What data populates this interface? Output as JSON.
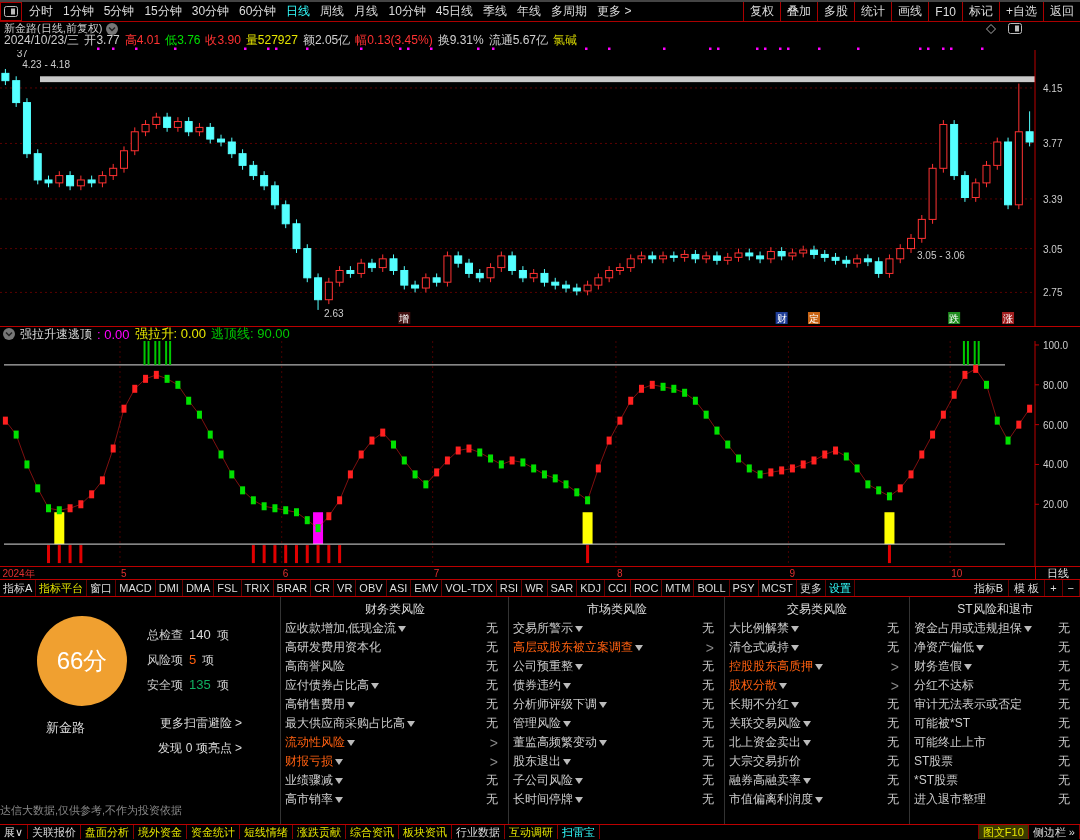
{
  "toolbar": {
    "periods": [
      {
        "label": "分时",
        "selected": false
      },
      {
        "label": "1分钟",
        "selected": false
      },
      {
        "label": "5分钟",
        "selected": false
      },
      {
        "label": "15分钟",
        "selected": false
      },
      {
        "label": "30分钟",
        "selected": false
      },
      {
        "label": "60分钟",
        "selected": false
      },
      {
        "label": "日线",
        "selected": true
      },
      {
        "label": "周线",
        "selected": false
      },
      {
        "label": "月线",
        "selected": false
      },
      {
        "label": "10分钟",
        "selected": false
      },
      {
        "label": "45日线",
        "selected": false
      },
      {
        "label": "季线",
        "selected": false
      },
      {
        "label": "年线",
        "selected": false
      },
      {
        "label": "多周期",
        "selected": false
      },
      {
        "label": "更多 >",
        "selected": false
      }
    ],
    "buttons": [
      "复权",
      "叠加",
      "多股",
      "统计",
      "画线",
      "F10",
      "标记",
      "+自选",
      "返回"
    ]
  },
  "quote": {
    "title": "新金路(日线,前复权)",
    "date": "2024/10/23/三",
    "fields": [
      {
        "label": "开",
        "value": "3.77",
        "color": "#d0d0d0"
      },
      {
        "label": "高",
        "value": "4.01",
        "color": "#ff3232"
      },
      {
        "label": "低",
        "value": "3.76",
        "color": "#00e000"
      },
      {
        "label": "收",
        "value": "3.90",
        "color": "#ff3232"
      },
      {
        "label": "量",
        "value": "527927",
        "color": "#e6e600"
      },
      {
        "label": "额",
        "value": "2.05亿",
        "color": "#d0d0d0"
      },
      {
        "label": "幅",
        "value": "0.13(3.45%)",
        "color": "#ff3232"
      },
      {
        "label": "换",
        "value": "9.31%",
        "color": "#d0d0d0"
      },
      {
        "label": "流通",
        "value": "5.67亿",
        "color": "#d0d0d0"
      }
    ],
    "sector": "氯碱"
  },
  "main_chart": {
    "chart_data": {
      "type": "candlestick",
      "ylim": [
        2.52,
        4.41
      ],
      "yticks": [
        2.75,
        3.05,
        3.39,
        3.77,
        4.15
      ],
      "grid": true,
      "ohlc": [
        [
          4.25,
          4.28,
          4.17,
          4.2
        ],
        [
          4.2,
          4.23,
          4.02,
          4.05
        ],
        [
          4.05,
          4.08,
          3.67,
          3.7
        ],
        [
          3.7,
          3.73,
          3.49,
          3.52
        ],
        [
          3.52,
          3.55,
          3.47,
          3.5
        ],
        [
          3.5,
          3.58,
          3.47,
          3.55
        ],
        [
          3.55,
          3.58,
          3.45,
          3.48
        ],
        [
          3.48,
          3.55,
          3.45,
          3.52
        ],
        [
          3.52,
          3.55,
          3.47,
          3.5
        ],
        [
          3.5,
          3.58,
          3.47,
          3.55
        ],
        [
          3.55,
          3.63,
          3.52,
          3.6
        ],
        [
          3.6,
          3.75,
          3.57,
          3.72
        ],
        [
          3.72,
          3.88,
          3.69,
          3.85
        ],
        [
          3.85,
          3.93,
          3.82,
          3.9
        ],
        [
          3.9,
          3.98,
          3.87,
          3.95
        ],
        [
          3.95,
          3.98,
          3.85,
          3.88
        ],
        [
          3.88,
          3.95,
          3.85,
          3.92
        ],
        [
          3.92,
          3.95,
          3.82,
          3.85
        ],
        [
          3.85,
          3.91,
          3.82,
          3.88
        ],
        [
          3.88,
          3.91,
          3.77,
          3.8
        ],
        [
          3.8,
          3.83,
          3.75,
          3.78
        ],
        [
          3.78,
          3.81,
          3.67,
          3.7
        ],
        [
          3.7,
          3.73,
          3.59,
          3.62
        ],
        [
          3.62,
          3.65,
          3.52,
          3.55
        ],
        [
          3.55,
          3.58,
          3.45,
          3.48
        ],
        [
          3.48,
          3.51,
          3.32,
          3.35
        ],
        [
          3.35,
          3.38,
          3.19,
          3.22
        ],
        [
          3.22,
          3.25,
          3.02,
          3.05
        ],
        [
          3.05,
          3.08,
          2.82,
          2.85
        ],
        [
          2.85,
          2.88,
          2.63,
          2.7
        ],
        [
          2.7,
          2.85,
          2.67,
          2.82
        ],
        [
          2.82,
          2.93,
          2.79,
          2.9
        ],
        [
          2.9,
          2.93,
          2.85,
          2.88
        ],
        [
          2.88,
          2.98,
          2.85,
          2.95
        ],
        [
          2.95,
          2.98,
          2.89,
          2.92
        ],
        [
          2.92,
          3.01,
          2.89,
          2.98
        ],
        [
          2.98,
          3.01,
          2.87,
          2.9
        ],
        [
          2.9,
          2.93,
          2.77,
          2.8
        ],
        [
          2.8,
          2.83,
          2.75,
          2.78
        ],
        [
          2.78,
          2.88,
          2.75,
          2.85
        ],
        [
          2.85,
          2.88,
          2.79,
          2.82
        ],
        [
          2.82,
          3.03,
          2.79,
          3.0
        ],
        [
          3.0,
          3.03,
          2.92,
          2.95
        ],
        [
          2.95,
          2.98,
          2.85,
          2.88
        ],
        [
          2.88,
          2.91,
          2.82,
          2.85
        ],
        [
          2.85,
          2.95,
          2.82,
          2.92
        ],
        [
          2.92,
          3.03,
          2.89,
          3.0
        ],
        [
          3.0,
          3.03,
          2.87,
          2.9
        ],
        [
          2.9,
          2.93,
          2.82,
          2.85
        ],
        [
          2.85,
          2.91,
          2.82,
          2.88
        ],
        [
          2.88,
          2.91,
          2.79,
          2.82
        ],
        [
          2.82,
          2.85,
          2.77,
          2.8
        ],
        [
          2.8,
          2.83,
          2.75,
          2.78
        ],
        [
          2.78,
          2.81,
          2.73,
          2.76
        ],
        [
          2.76,
          2.83,
          2.73,
          2.8
        ],
        [
          2.8,
          2.88,
          2.77,
          2.85
        ],
        [
          2.85,
          2.93,
          2.82,
          2.9
        ],
        [
          2.9,
          2.95,
          2.87,
          2.92
        ],
        [
          2.92,
          3.01,
          2.89,
          2.98
        ],
        [
          2.98,
          3.03,
          2.95,
          3.0
        ],
        [
          3.0,
          3.03,
          2.95,
          2.98
        ],
        [
          2.98,
          3.03,
          2.95,
          3.0
        ],
        [
          3.0,
          3.03,
          2.96,
          2.99
        ],
        [
          2.99,
          3.04,
          2.96,
          3.01
        ],
        [
          3.01,
          3.04,
          2.95,
          2.98
        ],
        [
          2.98,
          3.03,
          2.95,
          3.0
        ],
        [
          3.0,
          3.03,
          2.94,
          2.97
        ],
        [
          2.97,
          3.02,
          2.94,
          2.99
        ],
        [
          2.99,
          3.05,
          2.96,
          3.02
        ],
        [
          3.02,
          3.05,
          2.97,
          3.0
        ],
        [
          3.0,
          3.03,
          2.95,
          2.98
        ],
        [
          2.98,
          3.06,
          2.95,
          3.03
        ],
        [
          3.03,
          3.06,
          2.97,
          3.0
        ],
        [
          3.0,
          3.05,
          2.97,
          3.02
        ],
        [
          3.02,
          3.07,
          2.99,
          3.04
        ],
        [
          3.04,
          3.07,
          2.98,
          3.01
        ],
        [
          3.01,
          3.04,
          2.96,
          2.99
        ],
        [
          2.99,
          3.02,
          2.94,
          2.97
        ],
        [
          2.97,
          3.0,
          2.92,
          2.95
        ],
        [
          2.95,
          3.01,
          2.92,
          2.98
        ],
        [
          2.98,
          3.01,
          2.93,
          2.96
        ],
        [
          2.96,
          2.99,
          2.85,
          2.88
        ],
        [
          2.88,
          3.01,
          2.85,
          2.98
        ],
        [
          2.98,
          3.08,
          2.95,
          3.05
        ],
        [
          3.05,
          3.15,
          3.02,
          3.12
        ],
        [
          3.12,
          3.28,
          3.09,
          3.25
        ],
        [
          3.25,
          3.63,
          3.22,
          3.6
        ],
        [
          3.6,
          3.93,
          3.57,
          3.9
        ],
        [
          3.9,
          3.93,
          3.52,
          3.55
        ],
        [
          3.55,
          3.58,
          3.37,
          3.4
        ],
        [
          3.4,
          3.53,
          3.37,
          3.5
        ],
        [
          3.5,
          3.65,
          3.47,
          3.62
        ],
        [
          3.62,
          3.81,
          3.59,
          3.78
        ],
        [
          3.78,
          3.81,
          3.32,
          3.35
        ],
        [
          3.35,
          4.18,
          3.32,
          3.85
        ],
        [
          3.85,
          3.99,
          3.75,
          3.78
        ]
      ],
      "annotations": [
        "37",
        "4.23 - 4.18",
        "2.63",
        "3.05 - 3.06"
      ]
    },
    "events": [
      {
        "text": "增",
        "color": "#401010"
      },
      {
        "text": "财",
        "color": "#1e3c96"
      },
      {
        "text": "定",
        "color": "#c86414"
      },
      {
        "text": "跌",
        "color": "#1e8c1e"
      },
      {
        "text": "涨",
        "color": "#a01e1e"
      }
    ]
  },
  "indicator": {
    "name": "强拉升速逃顶",
    "legend": [
      {
        "text": ": 0.00",
        "color": "#ff00ff"
      },
      {
        "text": "强拉升: 0.00",
        "color": "#e6e600"
      },
      {
        "text": "逃顶线: 90.00",
        "color": "#00c800"
      }
    ],
    "chart_data": {
      "type": "line",
      "ylim": [
        -11,
        102
      ],
      "grid": true,
      "yticks": [
        {
          "value": 20,
          "label": "20.00"
        },
        {
          "value": 40,
          "label": "40.00"
        },
        {
          "value": 60,
          "label": "60.00"
        },
        {
          "value": 80,
          "label": "80.00"
        },
        {
          "value": 100,
          "label": "100.0"
        }
      ],
      "series": [
        {
          "color": "#ff2020",
          "marker": "square",
          "values": [
            62,
            55,
            40,
            28,
            18,
            17,
            18,
            20,
            25,
            32,
            48,
            68,
            78,
            83,
            85,
            83,
            80,
            72,
            65,
            55,
            45,
            35,
            27,
            22,
            19,
            18,
            17,
            16,
            12,
            8,
            14,
            22,
            35,
            45,
            52,
            56,
            50,
            42,
            35,
            30,
            36,
            42,
            47,
            48,
            46,
            43,
            40,
            42,
            41,
            38,
            35,
            33,
            30,
            26,
            22,
            38,
            52,
            62,
            72,
            78,
            80,
            79,
            78,
            76,
            72,
            65,
            57,
            50,
            43,
            38,
            35,
            36,
            37,
            38,
            40,
            42,
            45,
            47,
            44,
            38,
            30,
            27,
            24,
            28,
            35,
            45,
            55,
            65,
            75,
            85,
            88,
            80,
            62,
            52,
            60,
            68
          ]
        }
      ]
    },
    "date_axis": {
      "labels": [
        "2024年",
        "5",
        "6",
        "7",
        "8",
        "9",
        "10"
      ],
      "period": "日线"
    }
  },
  "indicator_tabs": {
    "items": [
      {
        "label": "指标A",
        "kind": "label"
      },
      {
        "label": "指标平台",
        "kind": "platform"
      },
      {
        "label": "窗口",
        "kind": "normal"
      },
      {
        "label": "MACD",
        "kind": "normal"
      },
      {
        "label": "DMI",
        "kind": "normal"
      },
      {
        "label": "DMA",
        "kind": "normal"
      },
      {
        "label": "FSL",
        "kind": "normal"
      },
      {
        "label": "TRIX",
        "kind": "normal"
      },
      {
        "label": "BRAR",
        "kind": "normal"
      },
      {
        "label": "CR",
        "kind": "normal"
      },
      {
        "label": "VR",
        "kind": "normal"
      },
      {
        "label": "OBV",
        "kind": "normal"
      },
      {
        "label": "ASI",
        "kind": "normal"
      },
      {
        "label": "EMV",
        "kind": "normal"
      },
      {
        "label": "VOL-TDX",
        "kind": "normal"
      },
      {
        "label": "RSI",
        "kind": "normal"
      },
      {
        "label": "WR",
        "kind": "normal"
      },
      {
        "label": "SAR",
        "kind": "normal"
      },
      {
        "label": "KDJ",
        "kind": "normal"
      },
      {
        "label": "CCI",
        "kind": "normal"
      },
      {
        "label": "ROC",
        "kind": "normal"
      },
      {
        "label": "MTM",
        "kind": "normal"
      },
      {
        "label": "BOLL",
        "kind": "normal"
      },
      {
        "label": "PSY",
        "kind": "normal"
      },
      {
        "label": "MCST",
        "kind": "normal"
      },
      {
        "label": "更多",
        "kind": "normal"
      },
      {
        "label": "设置",
        "kind": "settings"
      }
    ],
    "right": [
      "指标B",
      "模 板",
      "+",
      "−"
    ]
  },
  "scan": {
    "score": "66分",
    "stock": "新金路",
    "stats": [
      {
        "label": "总检查",
        "value": "140",
        "unit": "项",
        "color": "#dddddd"
      },
      {
        "label": "风险项",
        "value": "5",
        "unit": "项",
        "color": "#ff6010"
      },
      {
        "label": "安全项",
        "value": "135",
        "unit": "项",
        "color": "#10b060"
      }
    ],
    "links": [
      "更多扫雷避险 >",
      "发现 0 项亮点 >"
    ],
    "disclaimer": "达信大数据,仅供参考,不作为投资依据",
    "columns": [
      {
        "title": "财务类风险",
        "items": [
          {
            "label": "应收款增加,低现金流",
            "menu": true,
            "risk": false,
            "status": "无"
          },
          {
            "label": "高研发费用资本化",
            "menu": false,
            "risk": false,
            "status": "无"
          },
          {
            "label": "高商誉风险",
            "menu": false,
            "risk": false,
            "status": "无"
          },
          {
            "label": "应付债券占比高",
            "menu": true,
            "risk": false,
            "status": "无"
          },
          {
            "label": "高销售费用",
            "menu": true,
            "risk": false,
            "status": "无"
          },
          {
            "label": "最大供应商采购占比高",
            "menu": true,
            "risk": false,
            "status": "无"
          },
          {
            "label": "流动性风险",
            "menu": true,
            "risk": true,
            "status": ">"
          },
          {
            "label": "财报亏损",
            "menu": true,
            "risk": true,
            "status": ">"
          },
          {
            "label": "业绩骤减",
            "menu": true,
            "risk": false,
            "status": "无"
          },
          {
            "label": "高市销率",
            "menu": true,
            "risk": false,
            "status": "无"
          }
        ]
      },
      {
        "title": "市场类风险",
        "items": [
          {
            "label": "交易所警示",
            "menu": true,
            "risk": false,
            "status": "无"
          },
          {
            "label": "高层或股东被立案调查",
            "menu": true,
            "risk": true,
            "status": ">"
          },
          {
            "label": "公司预重整",
            "menu": true,
            "risk": false,
            "status": "无"
          },
          {
            "label": "债券违约",
            "menu": true,
            "risk": false,
            "status": "无"
          },
          {
            "label": "分析师评级下调",
            "menu": true,
            "risk": false,
            "status": "无"
          },
          {
            "label": "管理风险",
            "menu": true,
            "risk": false,
            "status": "无"
          },
          {
            "label": "董监高频繁变动",
            "menu": true,
            "risk": false,
            "status": "无"
          },
          {
            "label": "股东退出",
            "menu": true,
            "risk": false,
            "status": "无"
          },
          {
            "label": "子公司风险",
            "menu": true,
            "risk": false,
            "status": "无"
          },
          {
            "label": "长时间停牌",
            "menu": true,
            "risk": false,
            "status": "无"
          }
        ]
      },
      {
        "title": "交易类风险",
        "items": [
          {
            "label": "大比例解禁",
            "menu": true,
            "risk": false,
            "status": "无"
          },
          {
            "label": "清仓式减持",
            "menu": true,
            "risk": false,
            "status": "无"
          },
          {
            "label": "控股股东高质押",
            "menu": true,
            "risk": true,
            "status": ">"
          },
          {
            "label": "股权分散",
            "menu": true,
            "risk": true,
            "status": ">"
          },
          {
            "label": "长期不分红",
            "menu": true,
            "risk": false,
            "status": "无"
          },
          {
            "label": "关联交易风险",
            "menu": true,
            "risk": false,
            "status": "无"
          },
          {
            "label": "北上资金卖出",
            "menu": true,
            "risk": false,
            "status": "无"
          },
          {
            "label": "大宗交易折价",
            "menu": false,
            "risk": false,
            "status": "无"
          },
          {
            "label": "融券高融卖率",
            "menu": true,
            "risk": false,
            "status": "无"
          },
          {
            "label": "市值偏离利润度",
            "menu": true,
            "risk": false,
            "status": "无"
          }
        ]
      },
      {
        "title": "ST风险和退市",
        "items": [
          {
            "label": "资金占用或违规担保",
            "menu": true,
            "risk": false,
            "status": "无"
          },
          {
            "label": "净资产偏低",
            "menu": true,
            "risk": false,
            "status": "无"
          },
          {
            "label": "财务造假",
            "menu": true,
            "risk": false,
            "status": "无"
          },
          {
            "label": "分红不达标",
            "menu": false,
            "risk": false,
            "status": "无"
          },
          {
            "label": "审计无法表示或否定",
            "menu": false,
            "risk": false,
            "status": "无"
          },
          {
            "label": "可能被*ST",
            "menu": false,
            "risk": false,
            "status": "无"
          },
          {
            "label": "可能终止上市",
            "menu": false,
            "risk": false,
            "status": "无"
          },
          {
            "label": "ST股票",
            "menu": false,
            "risk": false,
            "status": "无"
          },
          {
            "label": "*ST股票",
            "menu": false,
            "risk": false,
            "status": "无"
          },
          {
            "label": "进入退市整理",
            "menu": false,
            "risk": false,
            "status": "无"
          }
        ]
      }
    ]
  },
  "taskbar": {
    "items": [
      {
        "label": "展∨",
        "kind": "plain"
      },
      {
        "label": "关联报价",
        "kind": "plain"
      },
      {
        "label": "盘面分析",
        "kind": "yellow"
      },
      {
        "label": "境外资金",
        "kind": "yellow"
      },
      {
        "label": "资金统计",
        "kind": "yellow"
      },
      {
        "label": "短线情绪",
        "kind": "yellow"
      },
      {
        "label": "涨跌贡献",
        "kind": "yellow"
      },
      {
        "label": "综合资讯",
        "kind": "yellow"
      },
      {
        "label": "板块资讯",
        "kind": "yellow"
      },
      {
        "label": "行业数据",
        "kind": "plain"
      },
      {
        "label": "互动调研",
        "kind": "yellow"
      },
      {
        "label": "扫雷宝",
        "kind": "active"
      }
    ],
    "right": [
      {
        "label": "图文F10",
        "kind": "highlight"
      },
      {
        "label": "侧边栏 »",
        "kind": "plain"
      }
    ]
  }
}
